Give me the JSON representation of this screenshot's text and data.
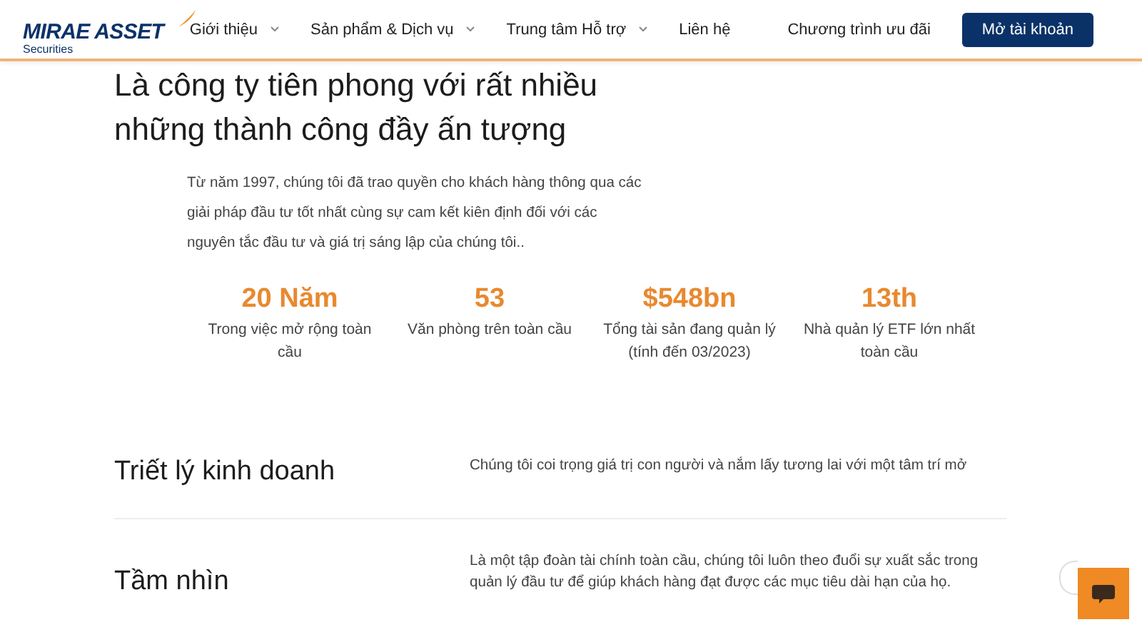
{
  "header": {
    "logo": {
      "name": "MIRAE ASSET",
      "subtitle": "Securities"
    },
    "nav": [
      {
        "label": "Giới thiệu",
        "dropdown": true
      },
      {
        "label": "Sản phẩm & Dịch vụ",
        "dropdown": true
      },
      {
        "label": "Trung tâm Hỗ trợ",
        "dropdown": true
      },
      {
        "label": "Liên hệ",
        "dropdown": false
      },
      {
        "label": "Chương trình ưu đãi",
        "dropdown": false
      }
    ],
    "cta": "Mở tài khoản"
  },
  "hero": {
    "title": "Là công ty tiên phong với rất nhiều những thành công đầy ấn tượng",
    "intro": "Từ năm 1997, chúng tôi đã trao quyền cho khách hàng thông qua các giải pháp đầu tư tốt nhất cùng sự cam kết kiên định đối với các nguyên tắc đầu tư và giá trị sáng lập của chúng tôi.."
  },
  "stats": [
    {
      "value": "20 Năm",
      "label": "Trong việc mở rộng toàn cầu"
    },
    {
      "value": "53",
      "label": "Văn phòng trên toàn cầu"
    },
    {
      "value": "$548bn",
      "label": "Tổng tài sản đang quản lý",
      "note": "(tính đến 03/2023)"
    },
    {
      "value": "13th",
      "label": "Nhà quản lý ETF lớn nhất toàn cầu"
    }
  ],
  "sections": [
    {
      "heading": "Triết lý kinh doanh",
      "text": "Chúng tôi coi trọng giá trị con người và nắm lấy tương lai với một tâm trí mở"
    },
    {
      "heading": "Tầm nhìn",
      "text": "Là một tập đoàn tài chính toàn cầu, chúng tôi luôn theo đuổi sự xuất sắc trong quản lý đầu tư để giúp khách hàng đạt được các mục tiêu dài hạn của họ."
    }
  ]
}
